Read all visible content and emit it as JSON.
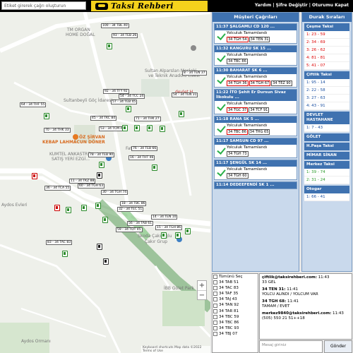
{
  "topbar": {
    "search_placeholder": "Etiket girerek çağrı oluşturun",
    "logo": "Taksi Rehberi",
    "links": "Yardım | Şifre Değiştir | Oturumu Kapat"
  },
  "map": {
    "labels": [
      "TM ORGAN",
      "HOME DOĞAL",
      "Sultan Alparslan Mesleki",
      "ve Teknik Anadolu Lisesi",
      "Sultanbeyli Göç İdaresi",
      "ÖZ ŞİRVAN",
      "KEBAP LAHMACUN DÖNER",
      "KUMTEL ANKASTRE",
      "SATIŞ YERİ EZGİ...",
      "Skoda Çakıroğlu",
      "Çakır Grup",
      "İBB Gölet Park",
      "Aydos Ormanı",
      "Fatih Cd.",
      "devlet H",
      "Aydos Evleri"
    ],
    "tags": [
      "100 - 34 TBL 40",
      "93 - 34 TEB 26",
      "64 - 34 THF 55",
      "92 - 34 TFY 92",
      "54 - 34 TCC 24",
      "57 - 34 TEB 45",
      "8 - 34 TEN 37",
      "54 - 34 TEN 31",
      "45 - 34 TKC 84",
      "53 - 34 TCM 47",
      "71 - 34 THK 27",
      "70 - 34 THK 33",
      "76 - 34 TEB 66",
      "78 - 34 TEB 90",
      "16 - 34 THT 46",
      "11 - 34 TKZ 88",
      "36 - 34 TCA 55",
      "60 - 34 TGH 63",
      "30 - 34 TGH 74",
      "32 - 34 TEC 51",
      "18 - 34 TBC 86",
      "14 - 34 TEN 10",
      "56 - 34 TAB 61",
      "59 - 34 TDT 45",
      "83 - 34 TAC 83",
      "15 - 34 TGH 86"
    ],
    "footer": "Keyboard shortcuts   Map data ©2022   Terms of Use"
  },
  "calls": {
    "header": "Müşteri Çağrıları",
    "items": [
      {
        "title": "11:37 ŞALGAMLI CD 120 ...",
        "status": "Yolculuk Tamamlandı",
        "plates": [
          {
            "p": "34 TGH 54",
            "red": true
          },
          {
            "p": "34 TEN 31",
            "red": false
          }
        ]
      },
      {
        "title": "11:32 KANGURU SK 15 ...",
        "status": "Yolculuk Tamamlandı",
        "plates": [
          {
            "p": "34 TBC 86",
            "red": false
          }
        ]
      },
      {
        "title": "11:30 BAHARAT SK 6 ...",
        "status": "Yolculuk Tamamlandı",
        "plates": [
          {
            "p": "34 TGH 36",
            "red": true
          },
          {
            "p": "34 TGH 67",
            "red": true
          },
          {
            "p": "34 TEZ 90",
            "red": false
          }
        ]
      },
      {
        "title": "11:22 İTO Şehit Er Dursun Sivaz İlkokulu ...",
        "status": "Yolculuk Tamamlandı",
        "plates": [
          {
            "p": "34 TGC 37",
            "red": true
          },
          {
            "p": "34 TCF 91",
            "red": false
          }
        ]
      },
      {
        "title": "11:18 RANA SK 5 ...",
        "status": "Yolculuk Tamamlandı",
        "plates": [
          {
            "p": "34 TBC 86",
            "red": true
          },
          {
            "p": "34 THG 65",
            "red": false
          }
        ]
      },
      {
        "title": "11:17 SAMSUN CD 97 ...",
        "status": "Yolculuk Tamamlandı",
        "plates": [
          {
            "p": "34 TGH 73",
            "red": false
          }
        ]
      },
      {
        "title": "11:17 ŞENGÜL SK 14 ...",
        "status": "Yolculuk Tamamlandı",
        "plates": [
          {
            "p": "34 TGH 60",
            "red": false
          }
        ]
      },
      {
        "title": "11:14 DEDEEFENDİ SK 1 ...",
        "status": "",
        "plates": []
      }
    ]
  },
  "queues": {
    "header": "Durak Sıraları",
    "groups": [
      {
        "title": "Çeşme Taksi",
        "rows": [
          "1: 23 - 59",
          "2: 34 - 69",
          "3: 26 - 62",
          "4: 81 - 81",
          "5: 41 - 07"
        ],
        "color": "red"
      },
      {
        "title": "Çiftlik Taksi",
        "rows": [
          "1: 95 - 14",
          "2: 22 - 58",
          "3: 27 - 63",
          "4: 43 - 91"
        ],
        "color": "blue"
      },
      {
        "title": "DEVLET HASTAHANE",
        "rows": [
          "1: 7 - 43"
        ],
        "color": "blue"
      },
      {
        "title": "GÖLET",
        "rows": [],
        "color": "blue"
      },
      {
        "title": "H.Paşa Taksi",
        "rows": [],
        "color": "blue"
      },
      {
        "title": "MİMAR SİNAN",
        "rows": [],
        "color": "blue"
      },
      {
        "title": "Merkez Taksi",
        "rows": [
          "1: 39 - 74",
          "2: 31 - 24"
        ],
        "color": "green"
      },
      {
        "title": "Otogar",
        "rows": [
          "1: 66 - 41"
        ],
        "color": "blue"
      }
    ]
  },
  "vehicles": {
    "all_label": "Tümünü Seç",
    "items": [
      "34 TAB 51",
      "34 TAC 83",
      "34 TAF 35",
      "34 TAJ 43",
      "34 TAN 92",
      "34 TAR 81",
      "34 TBC 59",
      "34 TBC 86",
      "34 TBC 93",
      "34 TBJ 07"
    ]
  },
  "chat": {
    "messages": [
      {
        "from": "çiftlik@taksirehberi.com:",
        "time": "11:43",
        "lines": [
          "33 GEL"
        ]
      },
      {
        "from": "34 TEN 31:",
        "time": "11:41",
        "lines": [
          "YOLCU ALINDI / YOLCUM VAR"
        ]
      },
      {
        "from": "34 TGH 68:",
        "time": "11:41",
        "lines": [
          "TAMAM / EVET"
        ]
      },
      {
        "from": "merkez9840@taksirehberi.com:",
        "time": "11:43",
        "lines": [
          "(505) 550 21 51++18"
        ]
      }
    ],
    "input_placeholder": "Mesaj giriniz",
    "send_label": "Gönder"
  }
}
